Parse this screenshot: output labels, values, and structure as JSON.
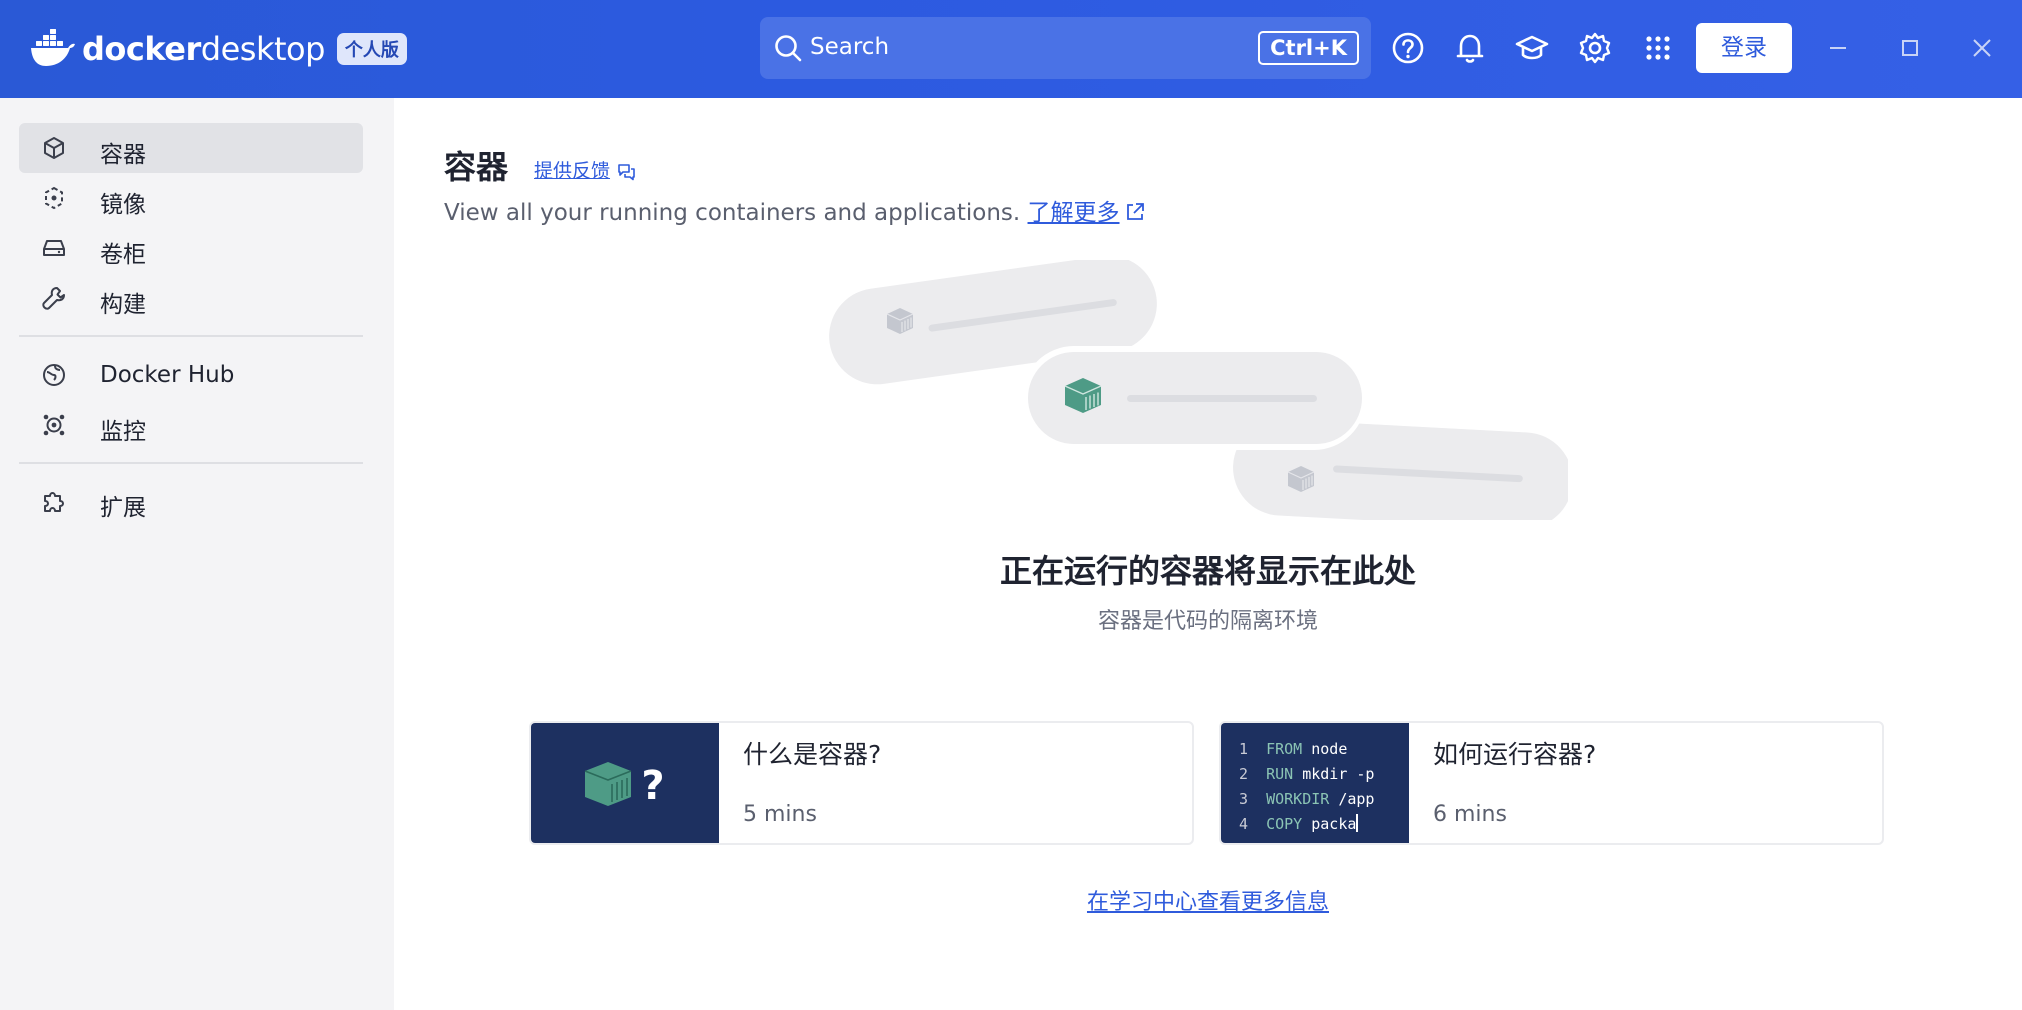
{
  "header": {
    "brand_word1": "docker",
    "brand_word2": "desktop",
    "edition": "个人版",
    "search_label": "Search",
    "search_shortcut": "Ctrl+K",
    "login_label": "登录",
    "icons": [
      "help-icon",
      "bell-icon",
      "learning-center-icon",
      "gear-icon",
      "apps-grid-icon"
    ],
    "window_controls": [
      "minimize-icon",
      "maximize-icon",
      "close-icon"
    ]
  },
  "sidebar": {
    "items": [
      {
        "label": "容器",
        "icon": "container-icon",
        "active": true
      },
      {
        "label": "镜像",
        "icon": "image-icon",
        "active": false
      },
      {
        "label": "卷柜",
        "icon": "volume-icon",
        "active": false
      },
      {
        "label": "构建",
        "icon": "wrench-icon",
        "active": false
      },
      {
        "label": "Docker Hub",
        "icon": "docker-hub-icon",
        "active": false
      },
      {
        "label": "监控",
        "icon": "monitor-icon",
        "active": false
      },
      {
        "label": "扩展",
        "icon": "puzzle-icon",
        "active": false
      }
    ]
  },
  "main": {
    "title": "容器",
    "feedback_link": "提供反馈",
    "subtitle": "View all your running containers and applications.",
    "learn_more_link": "了解更多",
    "empty_title": "正在运行的容器将显示在此处",
    "empty_subtitle": "容器是代码的隔离环境",
    "cards": [
      {
        "title": "什么是容器?",
        "duration": "5 mins"
      },
      {
        "title": "如何运行容器?",
        "duration": "6 mins",
        "code": [
          {
            "n": "1",
            "kw": "FROM",
            "rest": " node"
          },
          {
            "n": "2",
            "kw": "RUN",
            "rest": " mkdir -p"
          },
          {
            "n": "3",
            "kw": "WORKDIR",
            "rest": " /app"
          },
          {
            "n": "4",
            "kw": "COPY",
            "rest": " packa"
          }
        ]
      }
    ],
    "learning_center_link": "在学习中心查看更多信息"
  },
  "colors": {
    "header_blue": "#2c5ae0",
    "accent_link": "#2f5bdc",
    "card_thumb_navy": "#1d3060",
    "container_green": "#4e9b86",
    "sidebar_bg": "#f4f4f6"
  }
}
